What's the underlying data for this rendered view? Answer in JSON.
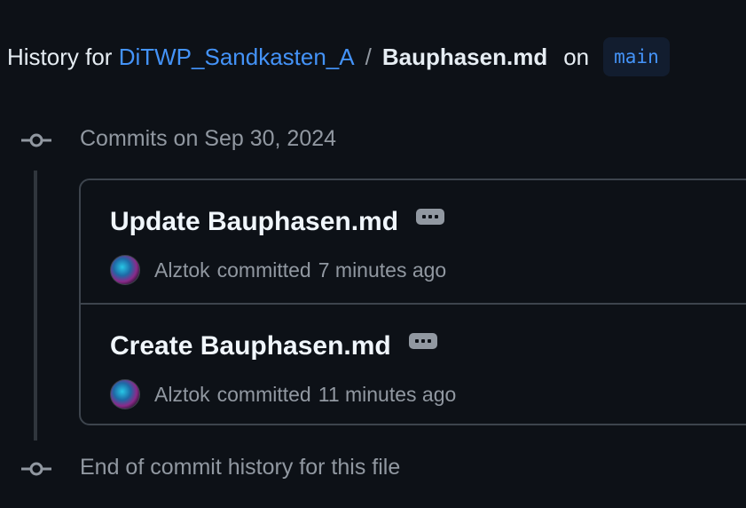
{
  "header": {
    "prefix": "History for",
    "repo": "DiTWP_Sandkasten_A",
    "separator": "/",
    "file": "Bauphasen.md",
    "on": "on",
    "branch": "main"
  },
  "timeline": {
    "group_label": "Commits on Sep 30, 2024",
    "end_label": "End of commit history for this file"
  },
  "commits": [
    {
      "title": "Update Bauphasen.md",
      "author": "Alztok",
      "verb": "committed",
      "time": "7 minutes ago"
    },
    {
      "title": "Create Bauphasen.md",
      "author": "Alztok",
      "verb": "committed",
      "time": "11 minutes ago"
    }
  ],
  "icons": {
    "timeline": "git-commit-icon",
    "more": "kebab-horizontal-icon"
  }
}
